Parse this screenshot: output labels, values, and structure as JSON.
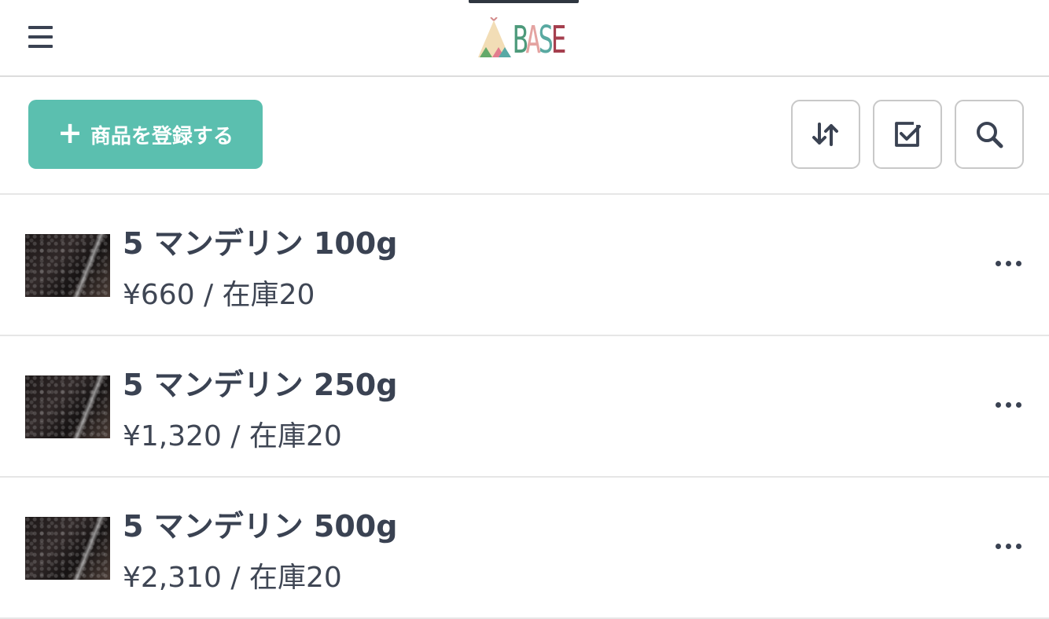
{
  "app": {
    "logo_text": "BASE"
  },
  "toolbar": {
    "add_label": "商品を登録する",
    "sort_icon": "sort-icon",
    "select_icon": "checkbox-icon",
    "search_icon": "search-icon"
  },
  "products": [
    {
      "name": "5 マンデリン 100g",
      "price_stock": "¥660 / 在庫20"
    },
    {
      "name": "5 マンデリン 250g",
      "price_stock": "¥1,320 / 在庫20"
    },
    {
      "name": "5 マンデリン 500g",
      "price_stock": "¥2,310 / 在庫20"
    }
  ],
  "colors": {
    "accent": "#5bbfaf",
    "text": "#3a4252",
    "logo_b": "#4d9a7b",
    "logo_a": "#e4a3a1",
    "logo_s": "#59a9a1",
    "logo_e": "#a53f4e"
  }
}
